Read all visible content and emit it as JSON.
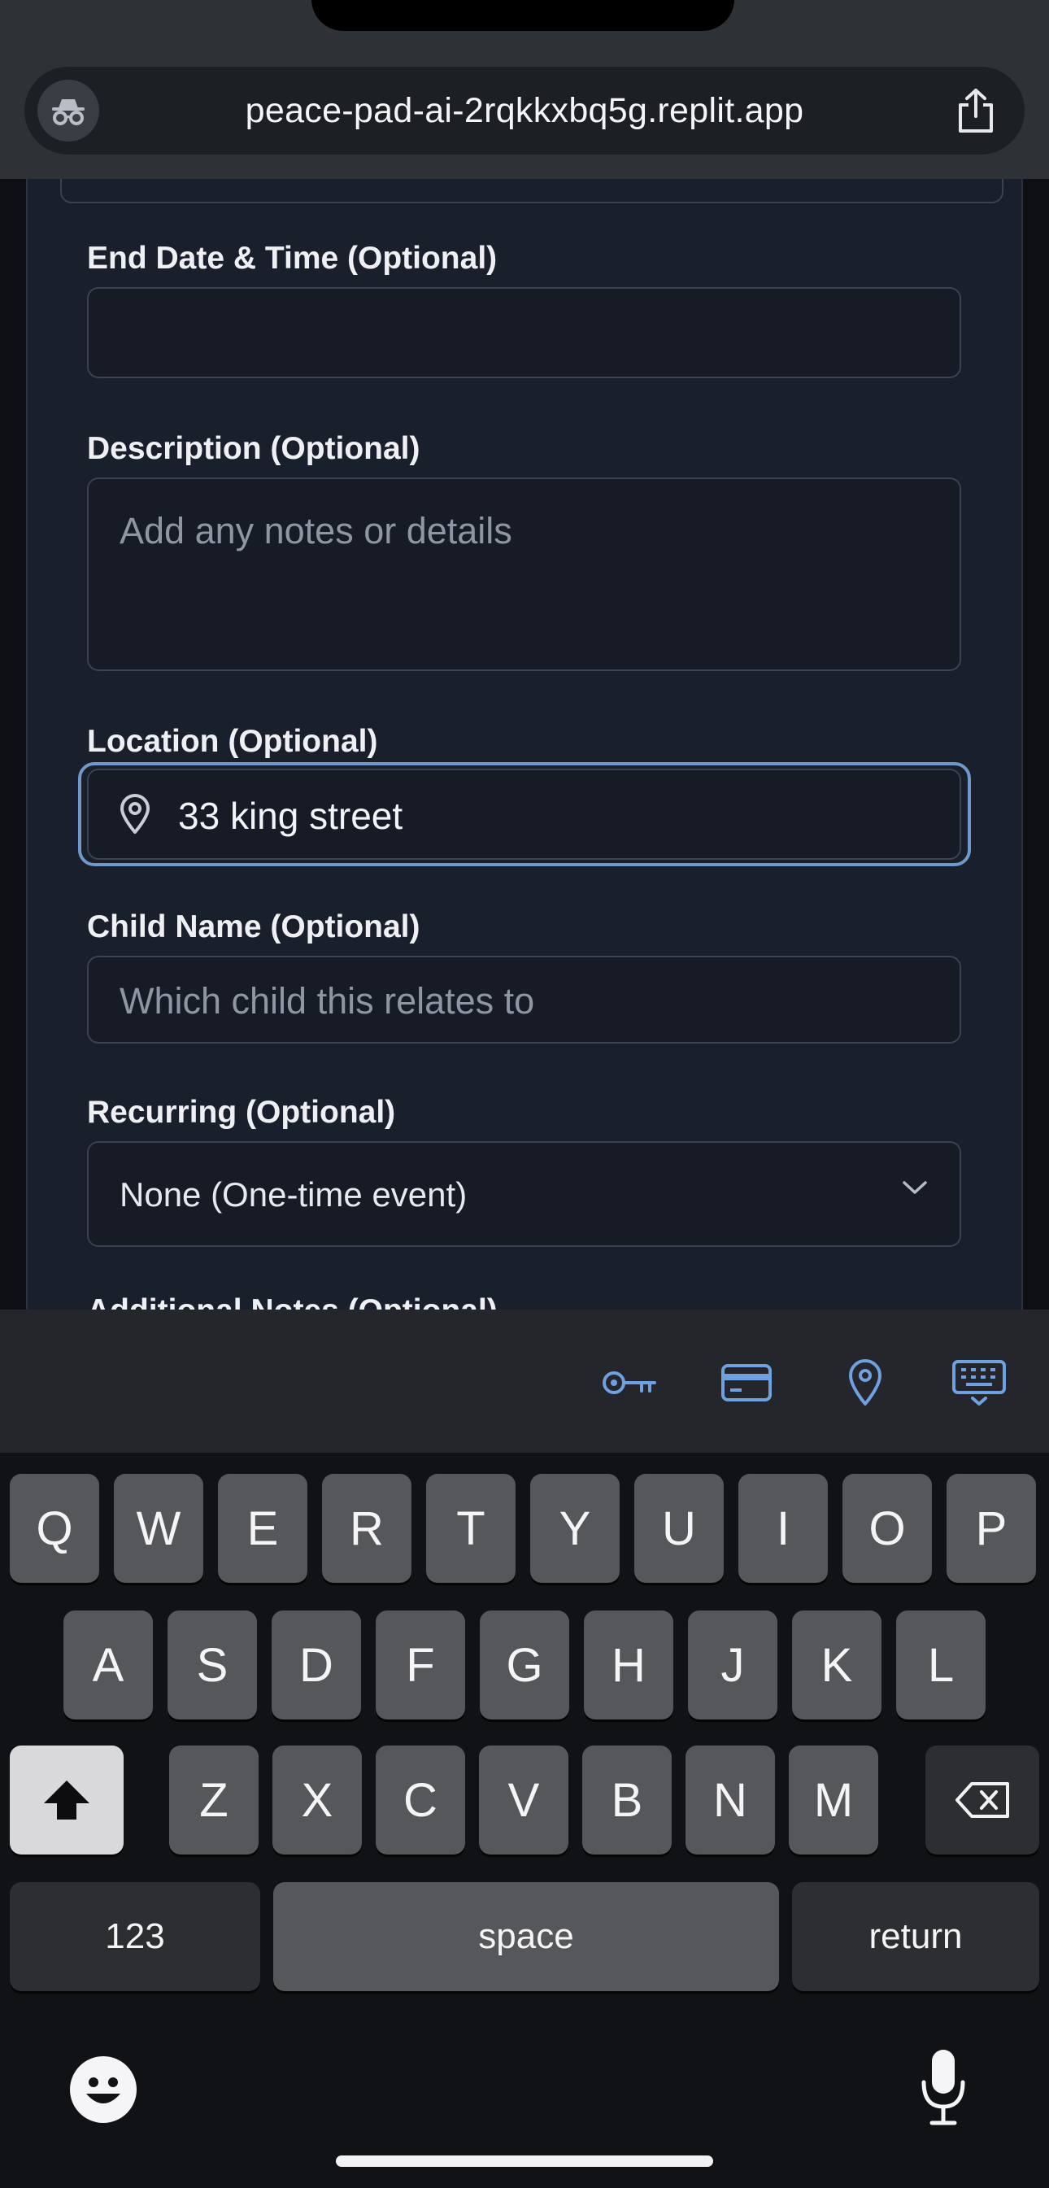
{
  "browser": {
    "url": "peace-pad-ai-2rqkkxbq5g.replit.app",
    "left_icon": "incognito-icon",
    "right_icon": "share-icon"
  },
  "form": {
    "end_date": {
      "label": "End Date & Time (Optional)",
      "value": ""
    },
    "description": {
      "label": "Description (Optional)",
      "placeholder": "Add any notes or details"
    },
    "location": {
      "label": "Location (Optional)",
      "value": "33 king street",
      "icon": "map-pin-icon"
    },
    "child_name": {
      "label": "Child Name (Optional)",
      "placeholder": "Which child this relates to"
    },
    "recurring": {
      "label": "Recurring (Optional)",
      "selected": "None (One-time event)"
    },
    "additional_notes": {
      "label": "Additional Notes (Optional)"
    }
  },
  "keyboard": {
    "accessory_icons": [
      "password-key-icon",
      "credit-card-icon",
      "location-pin-icon",
      "keyboard-dismiss-icon"
    ],
    "row1": [
      "Q",
      "W",
      "E",
      "R",
      "T",
      "Y",
      "U",
      "I",
      "O",
      "P"
    ],
    "row2": [
      "A",
      "S",
      "D",
      "F",
      "G",
      "H",
      "J",
      "K",
      "L"
    ],
    "row3": [
      "Z",
      "X",
      "C",
      "V",
      "B",
      "N",
      "M"
    ],
    "numbers_key": "123",
    "space_key": "space",
    "return_key": "return"
  },
  "colors": {
    "accent": "#6f99cc",
    "card_bg": "#1a1f2c",
    "keyboard_bg": "#111215"
  }
}
